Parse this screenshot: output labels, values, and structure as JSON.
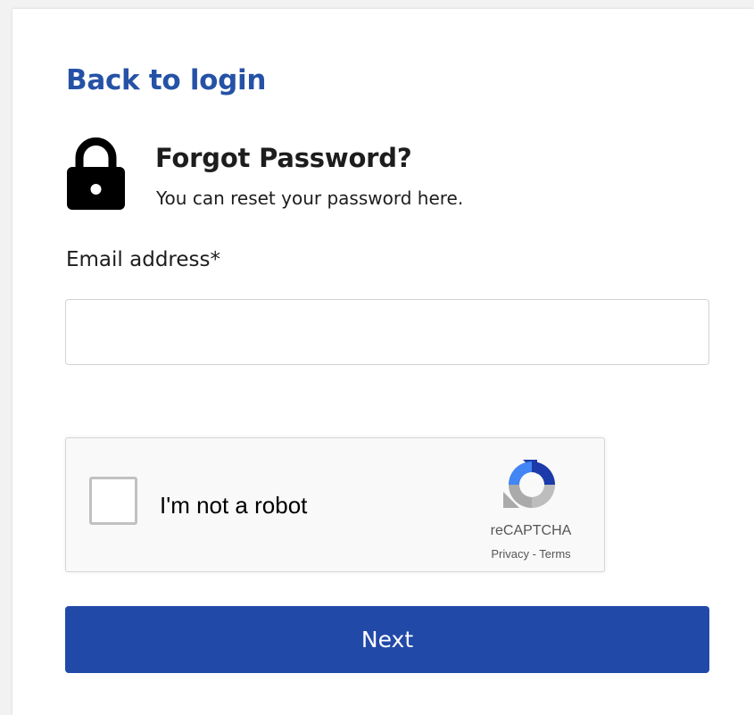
{
  "back_link": {
    "label": "Back to login"
  },
  "header": {
    "icon": "lock-icon",
    "title": "Forgot Password?",
    "subtitle": "You can reset your password here."
  },
  "form": {
    "email_label": "Email address*",
    "email_value": "",
    "email_placeholder": ""
  },
  "captcha": {
    "label": "I'm not a robot",
    "brand": "reCAPTCHA",
    "privacy": "Privacy",
    "separator": " - ",
    "terms": "Terms",
    "icon": "recaptcha-logo-icon"
  },
  "actions": {
    "next_label": "Next"
  },
  "colors": {
    "link": "#2552a6",
    "primary_button": "#2149a8",
    "text": "#1d1d1d"
  }
}
